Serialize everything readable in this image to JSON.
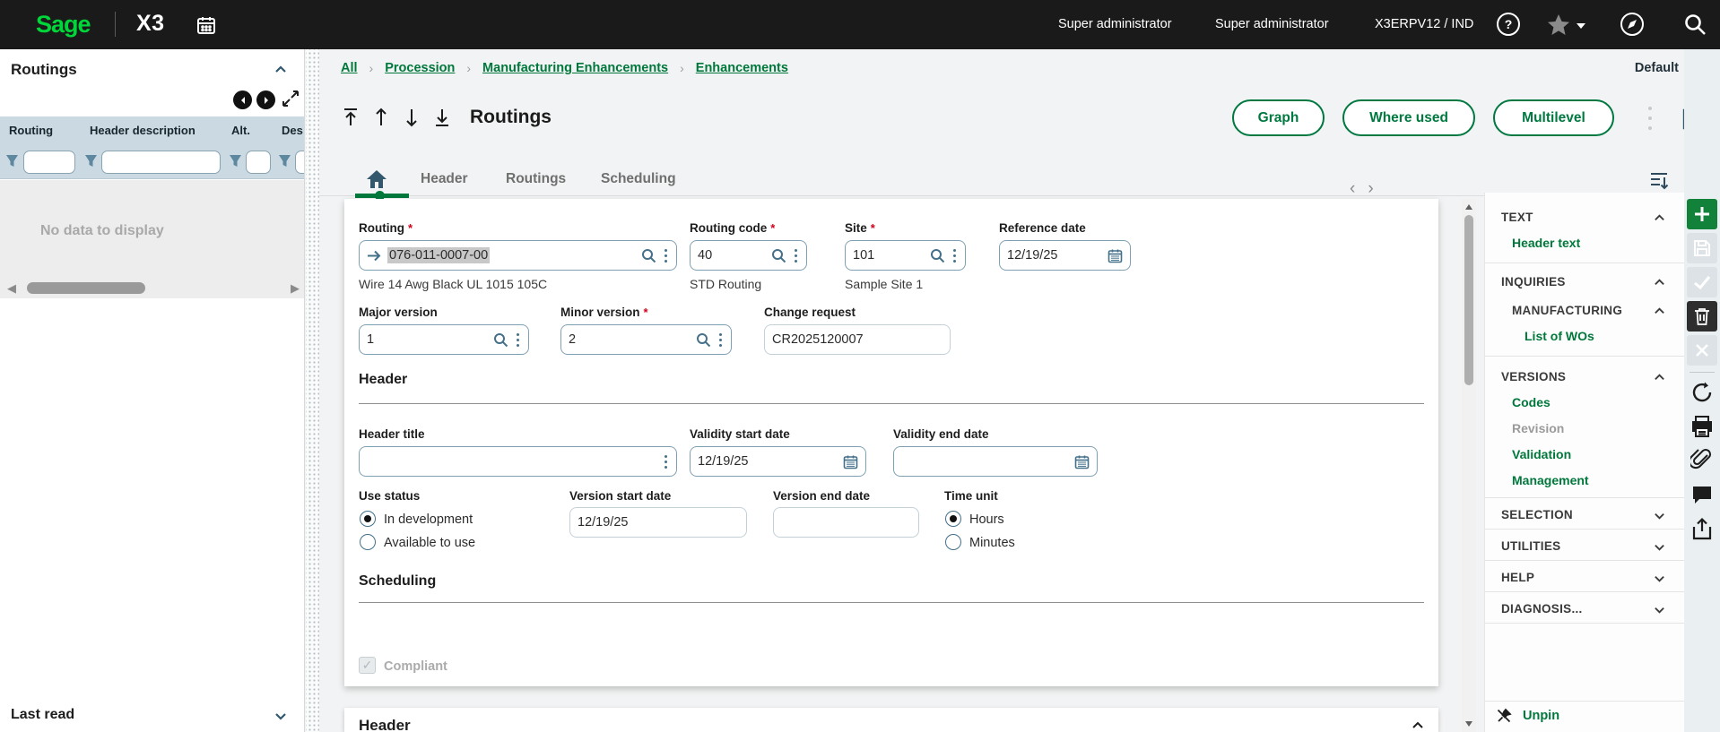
{
  "topbar": {
    "brand": "Sage",
    "product": "X3",
    "user_role": "Super administrator",
    "user_name": "Super administrator",
    "environment": "X3ERPV12 / IND"
  },
  "left_panel": {
    "title": "Routings",
    "columns": [
      "Routing",
      "Header description",
      "Alt.",
      "Des"
    ],
    "empty_message": "No data to display",
    "footer_label": "Last read"
  },
  "breadcrumb": {
    "items": [
      "All",
      "Procession",
      "Manufacturing Enhancements",
      "Enhancements"
    ],
    "separator": "›"
  },
  "page_header": {
    "title": "Routings",
    "view_selector": "Default",
    "buttons": [
      "Graph",
      "Where used",
      "Multilevel"
    ]
  },
  "tabs": {
    "items": [
      "Header",
      "Routings",
      "Scheduling"
    ]
  },
  "form": {
    "routing": {
      "label": "Routing",
      "value": "076-011-0007-00",
      "description": "Wire 14 Awg Black UL 1015 105C"
    },
    "routing_code": {
      "label": "Routing code",
      "value": "40",
      "description": "STD Routing"
    },
    "site": {
      "label": "Site",
      "value": "101",
      "description": "Sample Site 1"
    },
    "reference_date": {
      "label": "Reference date",
      "value": "12/19/25"
    },
    "major_version": {
      "label": "Major version",
      "value": "1"
    },
    "minor_version": {
      "label": "Minor version",
      "value": "2"
    },
    "change_request": {
      "label": "Change request",
      "value": "CR2025120007"
    },
    "header_section_title": "Header",
    "header_title": {
      "label": "Header title",
      "value": ""
    },
    "validity_start_date": {
      "label": "Validity start date",
      "value": "12/19/25"
    },
    "validity_end_date": {
      "label": "Validity end date",
      "value": ""
    },
    "use_status": {
      "label": "Use status",
      "options": [
        "In development",
        "Available to use"
      ],
      "selected": "In development"
    },
    "version_start_date": {
      "label": "Version start date",
      "value": "12/19/25"
    },
    "version_end_date": {
      "label": "Version end date",
      "value": ""
    },
    "time_unit": {
      "label": "Time unit",
      "options": [
        "Hours",
        "Minutes"
      ],
      "selected": "Hours"
    },
    "scheduling_section_title": "Scheduling",
    "compliant": {
      "label": "Compliant",
      "checked": true,
      "disabled": true,
      "checkmark": "✓"
    }
  },
  "bottom_card": {
    "title": "Header"
  },
  "right_panel": {
    "sections": [
      {
        "label": "TEXT",
        "items": [
          "Header text"
        ]
      },
      {
        "label": "INQUIRIES",
        "subsection": "MANUFACTURING",
        "items": [
          "List of WOs"
        ]
      },
      {
        "label": "VERSIONS",
        "items": [
          "Codes",
          "Revision",
          "Validation",
          "Management"
        ]
      },
      {
        "label": "SELECTION"
      },
      {
        "label": "UTILITIES"
      },
      {
        "label": "HELP"
      },
      {
        "label": "DIAGNOSIS..."
      }
    ],
    "unpin_label": "Unpin"
  },
  "colors": {
    "accent_green": "#007841",
    "brand_green": "#00d639",
    "slate": "#33586e",
    "required_red": "#d0021b"
  }
}
